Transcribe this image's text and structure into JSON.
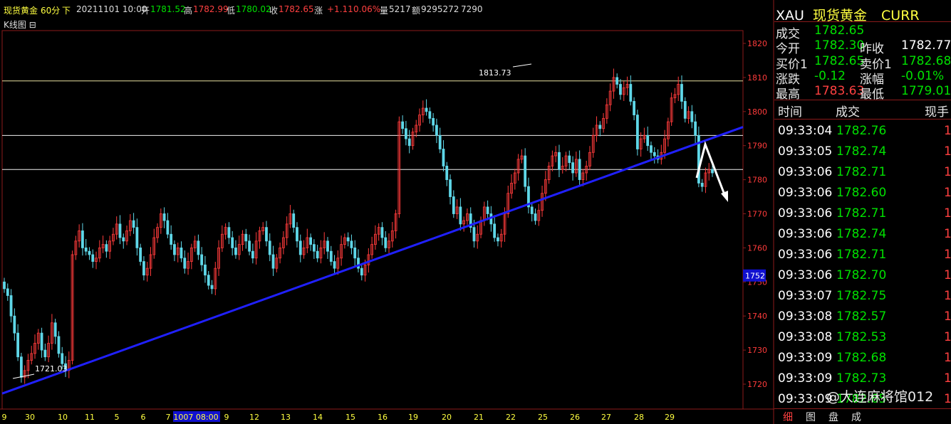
{
  "header": {
    "name": "现货黄金",
    "period": "60分",
    "dir": "下",
    "date": "20211101 10:00",
    "open_label": "开",
    "open": "1781.52",
    "high_label": "高",
    "high": "1782.99",
    "low_label": "低",
    "low": "1780.02",
    "close_label": "收",
    "close": "1782.65",
    "change_label": "涨",
    "change": "+1.11",
    "change_pct": "0.06%",
    "volume_label": "量",
    "volume": "5217",
    "amount_label": "额",
    "amount": "9295272",
    "extra": "7290"
  },
  "chart_label": "K线图",
  "chart_data": {
    "type": "candlestick",
    "y_ticks": [
      1820,
      1810,
      1800,
      1790,
      1780,
      1770,
      1760,
      1750,
      1740,
      1730,
      1720
    ],
    "ylim": [
      1714,
      1824
    ],
    "current_price_tag": "1752",
    "x_labels": [
      "9",
      "30",
      "10",
      "11",
      "5",
      "6",
      "7",
      "1007 08:00",
      "9",
      "12",
      "13",
      "14",
      "15",
      "16",
      "19",
      "20",
      "21",
      "22",
      "25",
      "26",
      "27",
      "28",
      "29"
    ],
    "annotations": [
      {
        "text": "1813.73",
        "value": 1813.73
      },
      {
        "text": "1721.03",
        "value": 1721.03
      }
    ],
    "horizontal_lines": [
      1809,
      1793,
      1783
    ],
    "trendline": {
      "from": 1721,
      "to": 1794
    },
    "closes": [
      1748,
      1746,
      1740,
      1735,
      1728,
      1722,
      1724,
      1727,
      1729,
      1732,
      1735,
      1730,
      1728,
      1732,
      1738,
      1734,
      1729,
      1726,
      1724,
      1727,
      1758,
      1762,
      1765,
      1760,
      1759,
      1758,
      1756,
      1757,
      1760,
      1761,
      1759,
      1762,
      1764,
      1767,
      1763,
      1762,
      1765,
      1768,
      1766,
      1760,
      1756,
      1752,
      1754,
      1758,
      1763,
      1766,
      1770,
      1768,
      1764,
      1761,
      1758,
      1760,
      1757,
      1754,
      1756,
      1760,
      1762,
      1758,
      1755,
      1752,
      1749,
      1748,
      1754,
      1760,
      1764,
      1766,
      1763,
      1760,
      1758,
      1761,
      1764,
      1762,
      1759,
      1757,
      1762,
      1765,
      1766,
      1762,
      1758,
      1754,
      1757,
      1760,
      1763,
      1767,
      1770,
      1766,
      1762,
      1758,
      1760,
      1763,
      1761,
      1759,
      1757,
      1760,
      1762,
      1759,
      1756,
      1754,
      1757,
      1761,
      1763,
      1762,
      1760,
      1757,
      1754,
      1752,
      1755,
      1758,
      1761,
      1764,
      1766,
      1763,
      1760,
      1762,
      1765,
      1770,
      1797,
      1795,
      1792,
      1790,
      1794,
      1796,
      1799,
      1801,
      1800,
      1798,
      1796,
      1793,
      1789,
      1784,
      1780,
      1775,
      1770,
      1772,
      1767,
      1768,
      1770,
      1766,
      1762,
      1764,
      1768,
      1772,
      1770,
      1767,
      1763,
      1762,
      1764,
      1770,
      1776,
      1779,
      1782,
      1786,
      1787,
      1778,
      1772,
      1770,
      1768,
      1771,
      1776,
      1780,
      1784,
      1787,
      1788,
      1783,
      1784,
      1787,
      1785,
      1782,
      1786,
      1780,
      1782,
      1784,
      1788,
      1793,
      1796,
      1795,
      1798,
      1802,
      1806,
      1810,
      1808,
      1805,
      1807,
      1808,
      1803,
      1799,
      1789,
      1792,
      1793,
      1790,
      1788,
      1787,
      1786,
      1788,
      1792,
      1797,
      1804,
      1805,
      1808,
      1803,
      1798,
      1800,
      1797,
      1793,
      1779,
      1778,
      1782,
      1783,
      1782
    ]
  },
  "panel": {
    "symbol": "XAU",
    "name": "现货黄金",
    "curr": "CURR",
    "trade_label": "成交",
    "trade": "1782.65",
    "open_label": "今开",
    "open": "1782.30",
    "prev_close_label": "昨收",
    "prev_close": "1782.77",
    "bid_label": "买价1",
    "bid": "1782.65",
    "ask_label": "卖价1",
    "ask": "1782.68",
    "change_label": "涨跌",
    "change": "-0.12",
    "change_pct_label": "涨幅",
    "change_pct": "-0.01%",
    "high_label": "最高",
    "high": "1783.63",
    "low_label": "最低",
    "low": "1779.01",
    "col_time": "时间",
    "col_price": "成交",
    "col_vol": "现手",
    "ticks": [
      {
        "time": "09:33:04",
        "price": "1782.76",
        "vol": "1"
      },
      {
        "time": "09:33:05",
        "price": "1782.74",
        "vol": "1"
      },
      {
        "time": "09:33:06",
        "price": "1782.71",
        "vol": "1"
      },
      {
        "time": "09:33:06",
        "price": "1782.60",
        "vol": "1"
      },
      {
        "time": "09:33:06",
        "price": "1782.71",
        "vol": "1"
      },
      {
        "time": "09:33:06",
        "price": "1782.74",
        "vol": "1"
      },
      {
        "time": "09:33:06",
        "price": "1782.71",
        "vol": "1"
      },
      {
        "time": "09:33:06",
        "price": "1782.70",
        "vol": "1"
      },
      {
        "time": "09:33:07",
        "price": "1782.75",
        "vol": "1"
      },
      {
        "time": "09:33:08",
        "price": "1782.57",
        "vol": "1"
      },
      {
        "time": "09:33:08",
        "price": "1782.53",
        "vol": "1"
      },
      {
        "time": "09:33:09",
        "price": "1782.68",
        "vol": "1"
      },
      {
        "time": "09:33:09",
        "price": "1782.73",
        "vol": "1"
      },
      {
        "time": "09:33:09",
        "price": "1782.65",
        "vol": "1"
      }
    ],
    "tabs": [
      "细",
      "图",
      "盘",
      "成"
    ]
  },
  "watermark": "@大连麻将馆012",
  "colors": {
    "up": "#ff3b3b",
    "down": "#5fd7e8",
    "trend": "#2020ff",
    "grid_border": "#8b1a1a",
    "green": "#00e000"
  }
}
